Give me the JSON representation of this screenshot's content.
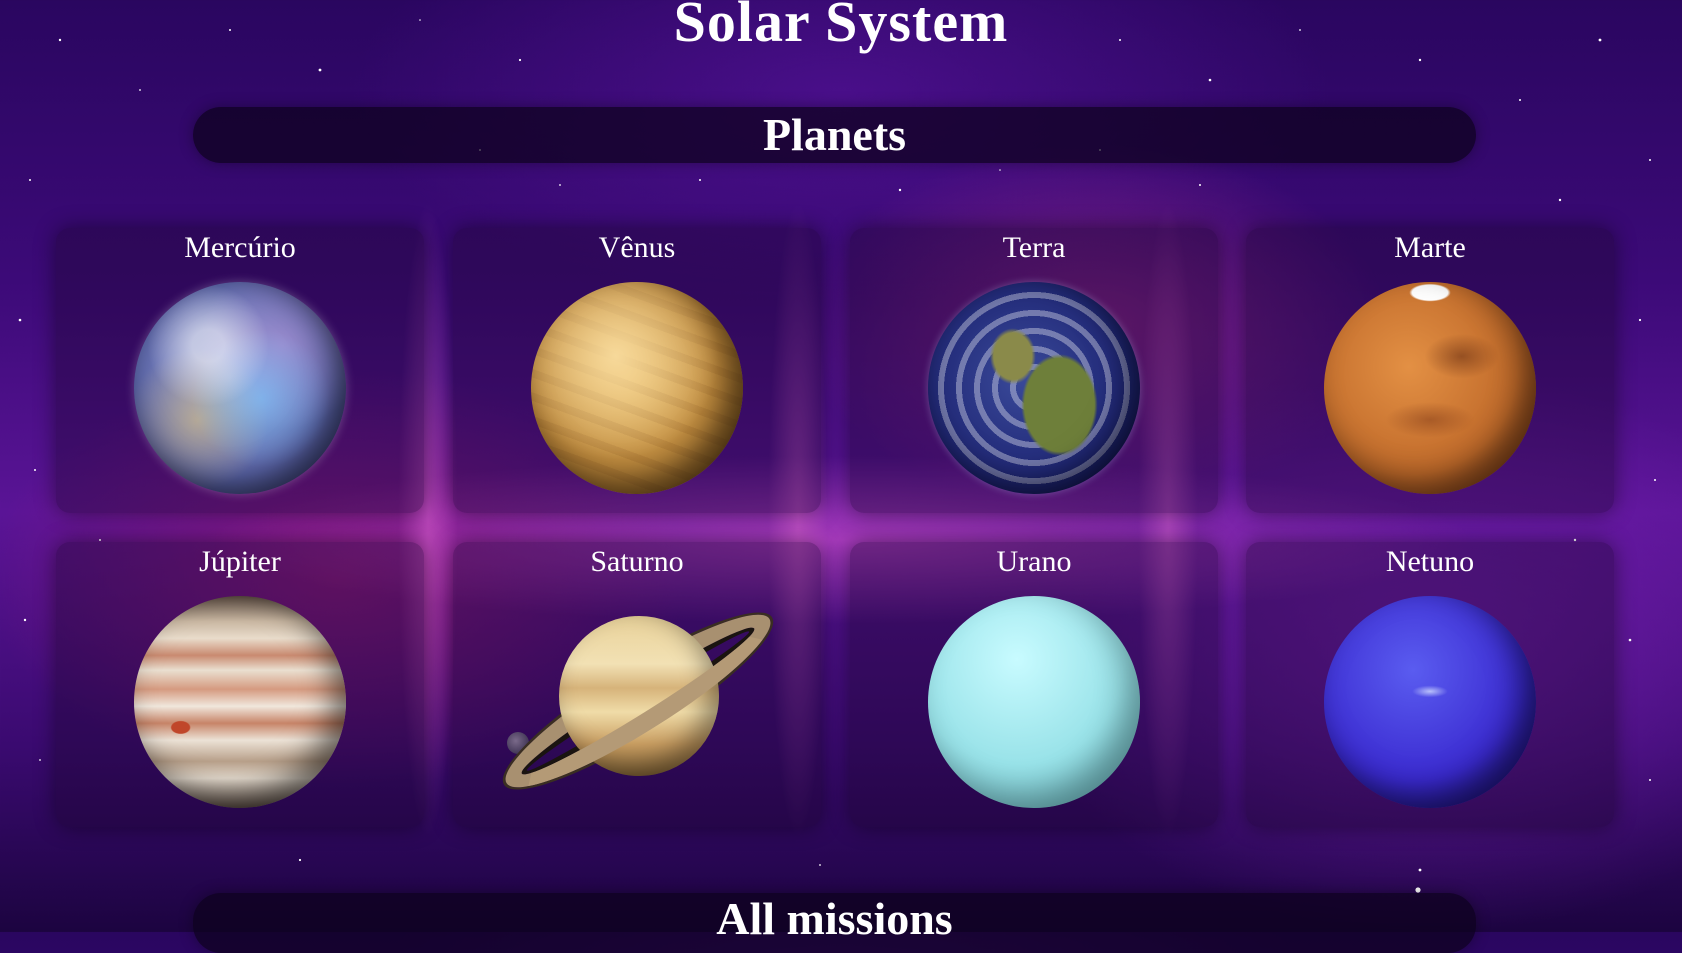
{
  "page": {
    "title": "Solar System"
  },
  "sections": {
    "planets_heading": "Planets",
    "missions_heading": "All missions"
  },
  "planets": [
    {
      "name": "Mercúrio",
      "icon": "mercury-planet-image"
    },
    {
      "name": "Vênus",
      "icon": "venus-planet-image"
    },
    {
      "name": "Terra",
      "icon": "earth-planet-image"
    },
    {
      "name": "Marte",
      "icon": "mars-planet-image"
    },
    {
      "name": "Júpiter",
      "icon": "jupiter-planet-image"
    },
    {
      "name": "Saturno",
      "icon": "saturn-planet-image"
    },
    {
      "name": "Urano",
      "icon": "uranus-planet-image"
    },
    {
      "name": "Netuno",
      "icon": "neptune-planet-image"
    }
  ],
  "colors": {
    "background": "#3c0a78",
    "text": "#ffffff",
    "section_bar": "#0c021c"
  }
}
